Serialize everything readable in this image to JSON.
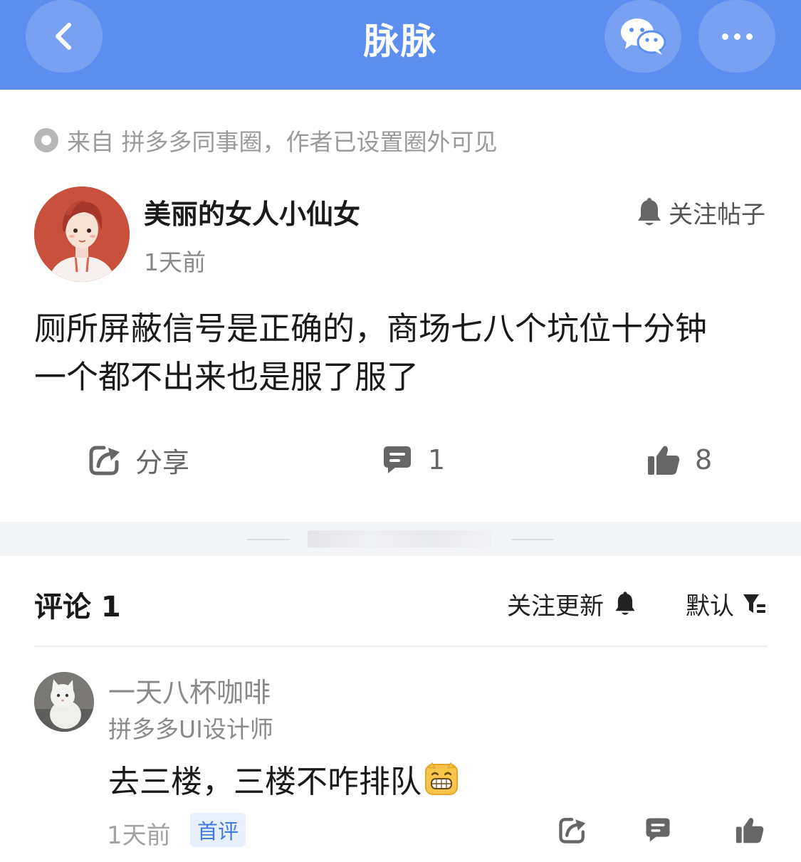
{
  "header": {
    "title": "脉脉",
    "back_icon": "chevron-left-icon",
    "wechat_icon": "wechat-icon",
    "more_icon": "more-dots-icon",
    "bg_color": "#5b8eee"
  },
  "source": {
    "text": "来自 拼多多同事圈，作者已设置圈外可见"
  },
  "post": {
    "author_name": "美丽的女人小仙女",
    "time": "1天前",
    "follow_label": "关注帖子",
    "content_line1": "厕所屏蔽信号是正确的，商场七八个坑位十分钟",
    "content_line2": "一个都不出来也是服了服了"
  },
  "actions": {
    "share_label": "分享",
    "comment_count": "1",
    "like_count": "8"
  },
  "comments_header": {
    "title": "评论 1",
    "follow_updates": "关注更新",
    "sort_label": "默认"
  },
  "comment": {
    "author": "一天八杯咖啡",
    "author_title": "拼多多UI设计师",
    "text": "去三楼，三楼不咋排队",
    "emoji": "grinning-face-emoji",
    "time": "1天前",
    "badge": "首评"
  }
}
